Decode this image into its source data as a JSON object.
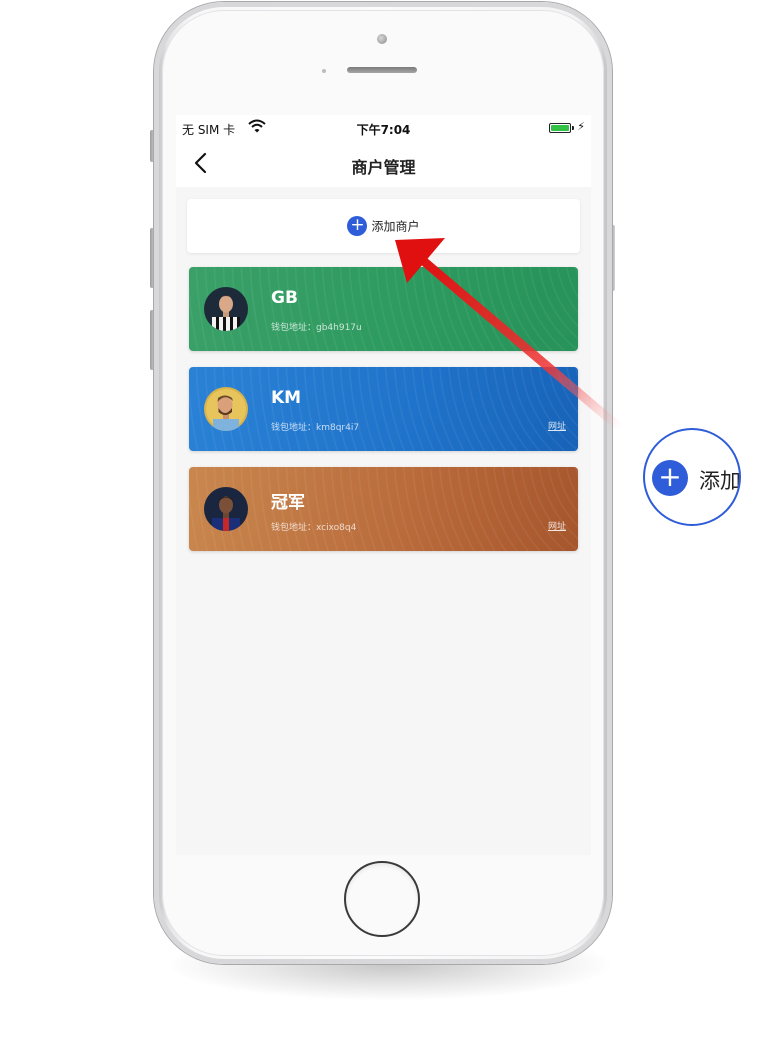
{
  "status_bar": {
    "carrier": "无 SIM 卡",
    "time": "下午7:04",
    "battery_level": 1.0
  },
  "nav": {
    "title": "商户管理",
    "back_icon": "chevron-left-icon"
  },
  "add_button": {
    "label": "添加商户",
    "icon": "plus-circle-icon"
  },
  "merchants": [
    {
      "name": "GB",
      "wallet_label": "钱包地址：gb4h917u",
      "link": "",
      "color": "#2f9e62"
    },
    {
      "name": "KM",
      "wallet_label": "钱包地址：km8qr4i7",
      "link": "网址",
      "color": "#1f72c9"
    },
    {
      "name": "冠军",
      "wallet_label": "钱包地址：xcixo8q4",
      "link": "网址",
      "color": "#b8693a"
    }
  ],
  "zoom_callout": {
    "label": "添加"
  },
  "colors": {
    "accent": "#2f5cd8",
    "arrow": "#e01010"
  }
}
